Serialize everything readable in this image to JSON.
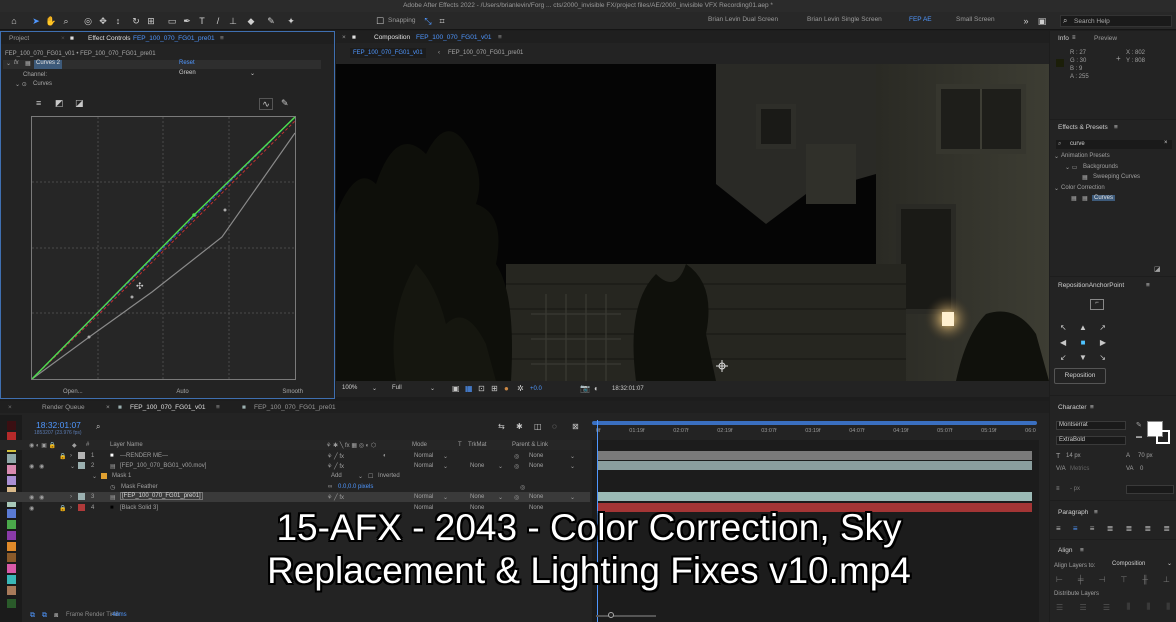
{
  "app": {
    "window_title": "Adobe After Effects 2022 - /Users/brianlevin/Forg ... cts/2000_invisible FX/project files/AE/2000_invisible VFX Recording01.aep *",
    "snapping_label": "Snapping",
    "workspaces": [
      "Brian Levin Dual Screen",
      "Brian Levin Single Screen",
      "FEP AE",
      "Small Screen"
    ],
    "active_workspace": "FEP AE",
    "search_help_placeholder": "Search Help"
  },
  "effect_controls": {
    "tab_project": "Project",
    "tab_label": "Effect Controls",
    "tab_layer": "FEP_100_070_FG01_pre01",
    "breadcrumb": "FEP_100_070_FG01_v01 • FEP_100_070_FG01_pre01",
    "effect_fx": "fx",
    "effect_name": "Curves 2",
    "reset_label": "Reset",
    "channel_label": "Channel:",
    "channel_value": "Green",
    "curves_label": "Curves",
    "footer": [
      "Open...",
      "Auto",
      "Smooth"
    ]
  },
  "composition": {
    "tab_label": "Composition",
    "tab_name": "FEP_100_070_FG01_v01",
    "crumb_active": "FEP_100_070_FG01_v01",
    "crumb_other": "FEP_100_070_FG01_pre01",
    "zoom": "100%",
    "resolution": "Full",
    "exposure": "+0.0",
    "timecode": "18:32:01:07"
  },
  "timeline": {
    "tab_render_queue": "Render Queue",
    "tab_comp": "FEP_100_070_FG01_v01",
    "tab_pre": "FEP_100_070_FG01_pre01",
    "current_time": "18:32:01:07",
    "fps_note": "1853207 (23.976 fps)",
    "col_layer_name": "Layer Name",
    "col_mode": "Mode",
    "col_t": "T",
    "col_trkmat": "TrkMat",
    "col_parent": "Parent & Link",
    "layers": [
      {
        "num": "1",
        "name": "—RENDER ME—",
        "mode": "Normal",
        "trkmat": "",
        "parent": "None",
        "color": "#b4b4b4"
      },
      {
        "num": "2",
        "name": "[FEP_100_070_BG01_v00.mov]",
        "mode": "Normal",
        "trkmat": "None",
        "parent": "None",
        "color": "#9bb0b0"
      },
      {
        "num": "3",
        "name": "[FEP_100_070_FG01_pre01]",
        "mode": "Normal",
        "trkmat": "None",
        "parent": "None",
        "color": "#9bb0b0"
      },
      {
        "num": "4",
        "name": "[Black Solid 3]",
        "mode": "Normal",
        "trkmat": "None",
        "parent": "None",
        "color": "#b03a3a"
      }
    ],
    "mask_name": "Mask 1",
    "mask_mode": "Add",
    "mask_inverted": "Inverted",
    "mask_feather_label": "Mask Feather",
    "mask_feather_value": "0.0,0.0 pixels",
    "ruler_ticks": [
      "0f",
      "01:19f",
      "02:07f",
      "02:19f",
      "03:07f",
      "03:19f",
      "04:07f",
      "04:19f",
      "05:07f",
      "05:19f",
      "06:0"
    ],
    "frame_render_label": "Frame Render Time",
    "frame_render_value": "48ms"
  },
  "info": {
    "tab_info": "Info",
    "tab_preview": "Preview",
    "r": "R : 27",
    "g": "G : 30",
    "b": "B : 9",
    "a": "A : 255",
    "x": "X : 802",
    "y": "Y : 808"
  },
  "effects_presets": {
    "title": "Effects & Presets",
    "search_value": "curve",
    "items": [
      "Animation Presets",
      "Backgrounds",
      "Sweeping Curves",
      "Color Correction",
      "Curves"
    ]
  },
  "reposition": {
    "title": "RepositionAnchorPoint",
    "button": "Reposition"
  },
  "character": {
    "title": "Character",
    "font": "Montserrat",
    "style": "ExtraBold",
    "size": "14 px",
    "leading": "70 px",
    "tracking_label": "Metrics",
    "kerning": "0",
    "unit": "- px"
  },
  "paragraph": {
    "title": "Paragraph"
  },
  "align": {
    "title": "Align",
    "align_to_label": "Align Layers to:",
    "align_to_value": "Composition",
    "distribute": "Distribute Layers"
  },
  "caption": {
    "line1": "15-AFX - 2043 - Color Correction, Sky",
    "line2": "Replacement & Lighting Fixes v10.mp4"
  }
}
